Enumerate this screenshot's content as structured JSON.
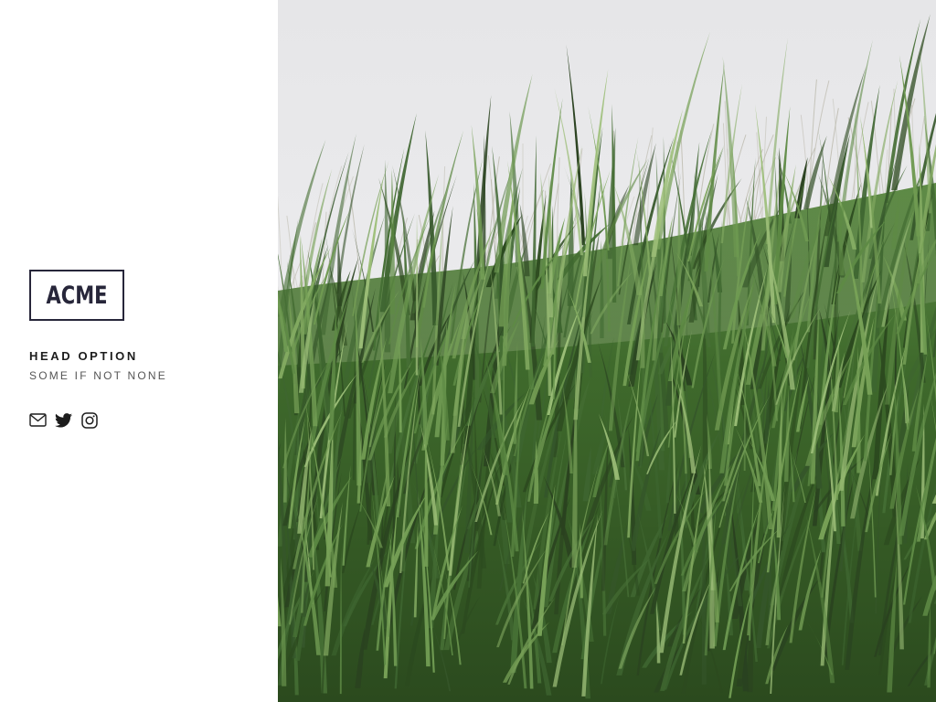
{
  "brand": {
    "logo_text": "ACME"
  },
  "profile": {
    "headline": "HEAD OPTION",
    "subline": "SOME IF NOT NONE"
  },
  "social": {
    "items": [
      {
        "icon": "mail-icon"
      },
      {
        "icon": "twitter-icon"
      },
      {
        "icon": "instagram-icon"
      }
    ]
  },
  "hero": {
    "subject": "windswept green reed grass against an overcast grey sky"
  },
  "colors": {
    "ink": "#27263a",
    "text": "#1c1c1c",
    "muted": "#555555",
    "sky": "#e9e9eb",
    "grass_dark": "#2f4a22",
    "grass_mid": "#4f7a38",
    "grass_light": "#8fb26a"
  }
}
